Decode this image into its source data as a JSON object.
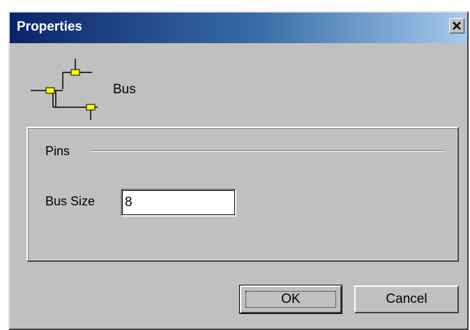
{
  "window": {
    "title": "Properties",
    "close_icon": "close-icon"
  },
  "header": {
    "icon": "bus-icon",
    "label": "Bus"
  },
  "pins_group": {
    "title": "Pins",
    "bus_size_label": "Bus Size",
    "bus_size_value": "8"
  },
  "buttons": {
    "ok_label": "OK",
    "cancel_label": "Cancel"
  },
  "colors": {
    "face": "#c0c0c0",
    "title_start": "#0a246a",
    "title_end": "#a6caf0",
    "bus_pin": "#ffff00"
  }
}
